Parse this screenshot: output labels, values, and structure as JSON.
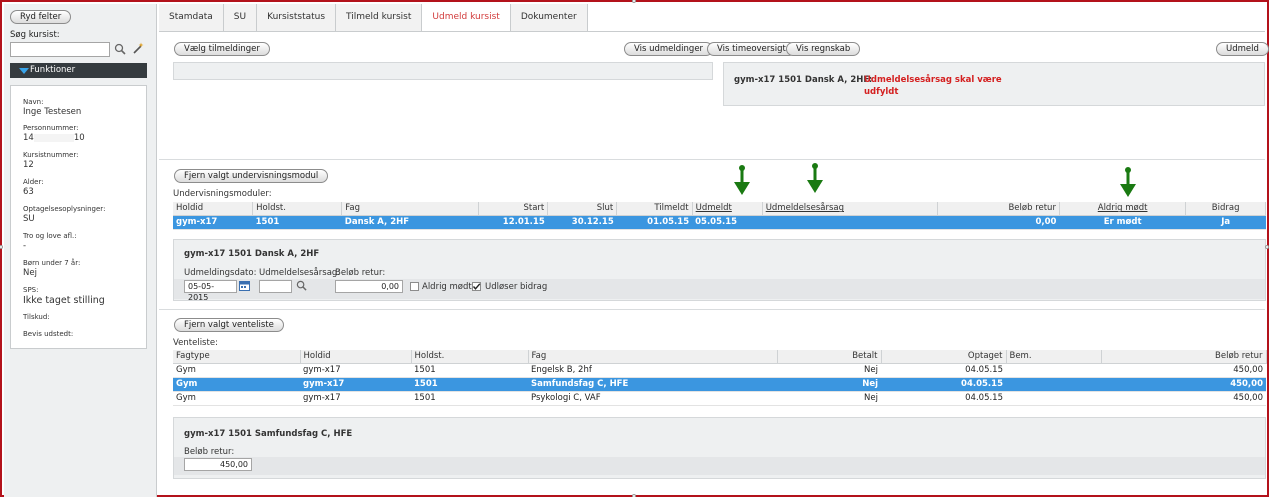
{
  "sidebar": {
    "clear_button": "Ryd felter",
    "search_label": "Søg kursist:",
    "search_value": "",
    "functions_label": "Funktioner",
    "fields": [
      {
        "key": "Navn:",
        "value": "Inge Testesen"
      },
      {
        "key": "Personnummer:",
        "value_prefix": "14",
        "value_suffix": "10"
      },
      {
        "key": "Kursistnummer:",
        "value": "12"
      },
      {
        "key": "Alder:",
        "value": "63"
      },
      {
        "key": "Optagelsesoplysninger:",
        "value": "SU"
      },
      {
        "key": "Tro og love afl.:",
        "value": "-"
      },
      {
        "key": "Børn under 7 år:",
        "value": "Nej"
      },
      {
        "key": "SPS:",
        "value": "Ikke taget stilling"
      },
      {
        "key": "Tilskud:",
        "value": ""
      },
      {
        "key": "Bevis udstedt:",
        "value": ""
      }
    ]
  },
  "tabs": [
    {
      "label": "Stamdata",
      "active": false
    },
    {
      "label": "SU",
      "active": false
    },
    {
      "label": "Kursiststatus",
      "active": false
    },
    {
      "label": "Tilmeld kursist",
      "active": false
    },
    {
      "label": "Udmeld kursist",
      "active": true
    },
    {
      "label": "Dokumenter",
      "active": false
    }
  ],
  "toolbar": {
    "select_registrations": "Vælg tilmeldinger",
    "show_deregistrations": "Vis udmeldinger",
    "show_hours": "Vis timeoversigt",
    "show_accounts": "Vis regnskab",
    "deregister": "Udmeld"
  },
  "message": {
    "context": "gym-x17 1501 Dansk A, 2HF:",
    "error_line1": "Udmeldelsesårsag skal være",
    "error_line2": "udfyldt",
    "error_color": "#d42020"
  },
  "modules": {
    "remove_button": "Fjern valgt undervisningsmodul",
    "label": "Undervisningsmoduler:",
    "columns": [
      "Holdid",
      "Holdst.",
      "Fag",
      "Start",
      "Slut",
      "Tilmeldt",
      "Udmeldt",
      "Udmeldelsesårsag",
      "Beløb retur",
      "Aldrig mødt",
      "Bidrag"
    ],
    "rows": [
      [
        "gym-x17",
        "1501",
        "Dansk A, 2HF",
        "12.01.15",
        "30.12.15",
        "01.05.15",
        "05.05.15",
        "",
        "0,00",
        "Er mødt",
        "Ja"
      ]
    ]
  },
  "detail1": {
    "title": "gym-x17 1501 Dansk A, 2HF",
    "date_label": "Udmeldingsdato:",
    "date_value": "05-05-2015",
    "reason_label": "Udmeldelsesårsag:",
    "reason_value": "",
    "amount_label": "Beløb retur:",
    "amount_value": "0,00",
    "never_attended_label": "Aldrig mødt",
    "never_attended_checked": false,
    "triggers_contribution_label": "Udløser bidrag",
    "triggers_contribution_checked": true
  },
  "waitlist": {
    "remove_button": "Fjern valgt venteliste",
    "label": "Venteliste:",
    "columns": [
      "Fagtype",
      "Holdid",
      "Holdst.",
      "Fag",
      "Betalt",
      "Optaget",
      "Bem.",
      "Beløb retur"
    ],
    "rows": [
      [
        "Gym",
        "gym-x17",
        "1501",
        "Engelsk B, 2hf",
        "Nej",
        "04.05.15",
        "",
        "450,00"
      ],
      [
        "Gym",
        "gym-x17",
        "1501",
        "Samfundsfag C, HFE",
        "Nej",
        "04.05.15",
        "",
        "450,00"
      ],
      [
        "Gym",
        "gym-x17",
        "1501",
        "Psykologi C, VAF",
        "Nej",
        "04.05.15",
        "",
        "450,00"
      ]
    ],
    "selected_index": 1
  },
  "detail2": {
    "title": "gym-x17 1501 Samfundsfag C, HFE",
    "amount_label": "Beløb retur:",
    "amount_value": "450,00"
  },
  "icons": {
    "search": "magnifier-icon",
    "wand": "magic-wand-icon",
    "calendar": "calendar-icon",
    "annotation_arrow": "green-down-arrow-icon"
  },
  "colors": {
    "accent_blue": "#3b96e0",
    "frame_red": "#b3121b",
    "active_tab": "#d23c3c",
    "arrow_green": "#1a7a12"
  }
}
